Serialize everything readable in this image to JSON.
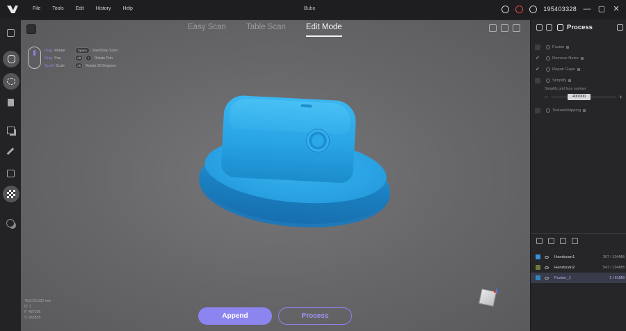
{
  "menu": [
    "File",
    "Tools",
    "Edit",
    "History",
    "Help"
  ],
  "app_title": "Bubo",
  "user_id": "195403328",
  "tabs": [
    {
      "label": "Easy Scan",
      "active": false
    },
    {
      "label": "Table Scan",
      "active": false
    },
    {
      "label": "Edit Mode",
      "active": true
    }
  ],
  "hints": {
    "col1": [
      {
        "key": "Drag",
        "action": "Rotate"
      },
      {
        "key": "Drag",
        "action": "Pan"
      },
      {
        "key": "Scroll",
        "action": "Scale"
      }
    ],
    "col2": [
      {
        "keys": [
          "Space"
        ],
        "action": "Start/Stop Scan"
      },
      {
        "keys": [
          "Alt",
          "+"
        ],
        "action": "Rotate Pan"
      },
      {
        "keys": [
          "Alt"
        ],
        "action": "Rotate 90 Degrees"
      }
    ]
  },
  "stats": {
    "size": "76x125x152 mm",
    "line1": "O: 1",
    "line2": "F: 487306",
    "line3": "V: 243655"
  },
  "buttons": {
    "append": "Append",
    "process": "Process"
  },
  "panel": {
    "title": "Process",
    "steps": [
      {
        "label": "Fusion",
        "checked": false
      },
      {
        "label": "Remove Noise",
        "checked": true
      },
      {
        "label": "Repair Gaps",
        "checked": true
      },
      {
        "label": "Simplify",
        "checked": false
      }
    ],
    "simplify_label": "Simplify grid face number",
    "simplify_value": "400000",
    "texture_step": {
      "label": "TextureMapping",
      "checked": false
    }
  },
  "layers": [
    {
      "name": "Handscan1",
      "size": "267 / 104MB",
      "color": "#3a8fd8",
      "selected": false
    },
    {
      "name": "Handscan2",
      "size": "547 / 194MB",
      "color": "#6e7a3a",
      "selected": false
    },
    {
      "name": "Fusion_1",
      "size": "1 / 61MB",
      "color": "#2c86c2",
      "selected": true
    }
  ],
  "colors": {
    "accent": "#8c84ef",
    "model": "#2aa2e3"
  }
}
